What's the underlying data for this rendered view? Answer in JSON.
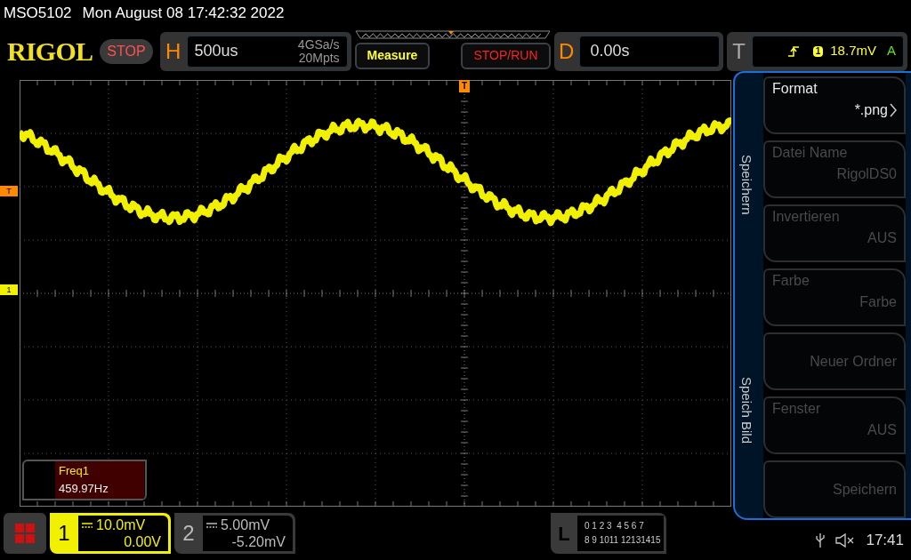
{
  "title_bar": {
    "model": "MSO5102",
    "datetime": "Mon August 08 17:42:32 2022"
  },
  "toolbar": {
    "logo": "RIGOL",
    "run_state": "STOP",
    "horizontal": {
      "letter": "H",
      "timebase": "500us",
      "sample_rate": "4GSa/s",
      "memory_depth": "20Mpts"
    },
    "buttons": [
      {
        "label": "Measure",
        "kind": "measure"
      },
      {
        "label": "STOP/RUN",
        "kind": "stoprun"
      }
    ],
    "delay": {
      "letter": "D",
      "value": "0.00s"
    },
    "trigger": {
      "letter": "T",
      "source": "1",
      "level": "18.7mV",
      "mode": "A"
    }
  },
  "scope": {
    "trigger_position_marker": "T",
    "trigger_level_marker": "T",
    "channel_marker": "1",
    "measurement": {
      "name": "Freq1",
      "value": "459.97Hz"
    }
  },
  "side_menu": {
    "tabs": [
      "Speichern",
      "Speich Bild"
    ],
    "items": [
      {
        "label": "Format",
        "setting": "*.png",
        "disabled": false,
        "submenu": true
      },
      {
        "label": "Datei Name",
        "setting": "RigolDS0",
        "disabled": true
      },
      {
        "label": "Invertieren",
        "setting": "AUS",
        "disabled": true
      },
      {
        "label": "Farbe",
        "setting": "Farbe",
        "disabled": true
      },
      {
        "label": "Neuer Ordner",
        "disabled": true
      },
      {
        "label": "Fenster",
        "setting": "AUS",
        "disabled": true
      },
      {
        "label": "Speichern",
        "disabled": true
      }
    ]
  },
  "channels": [
    {
      "number": "1",
      "scale": "10.0mV",
      "offset": "0.00V",
      "active": true
    },
    {
      "number": "2",
      "scale": "5.00mV",
      "offset": "-5.20mV",
      "active": false
    }
  ],
  "logic": {
    "letter": "L",
    "rows": [
      "0 1 2 3  4 5 6 7",
      "8 9 1011 12131415"
    ]
  },
  "status_bar": {
    "time": "17:41"
  }
}
